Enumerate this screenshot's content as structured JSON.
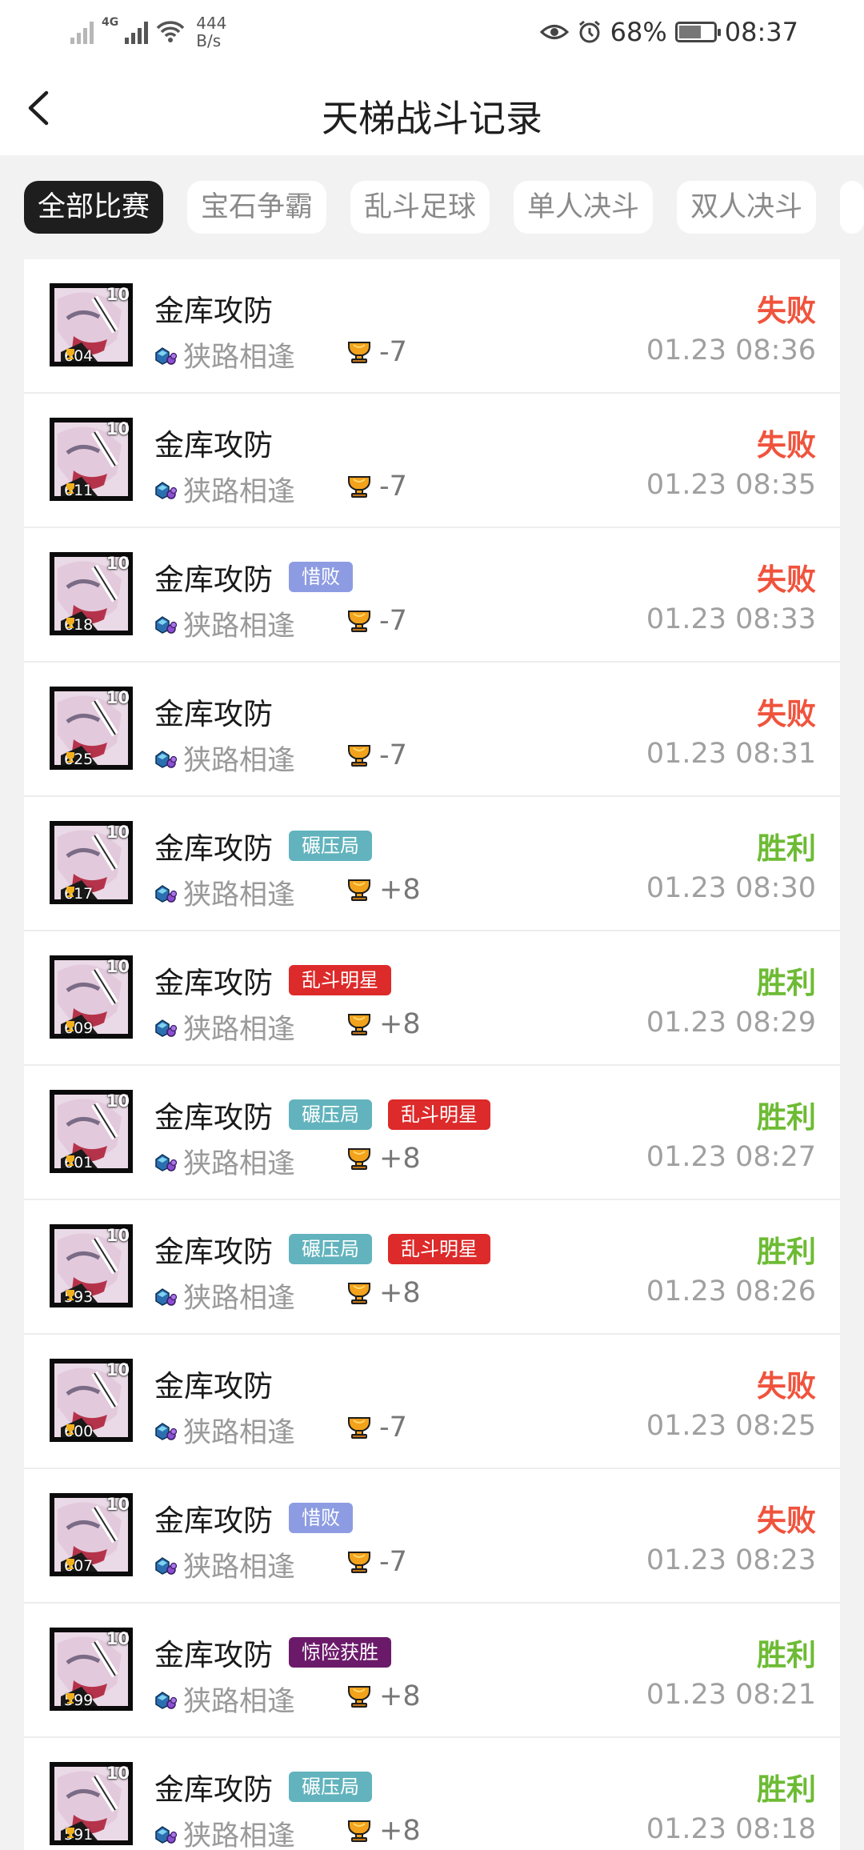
{
  "status_bar": {
    "net_speed_value": "444",
    "net_speed_unit": "B/s",
    "network_type": "4G",
    "battery": "68%",
    "battery_level": 0.68,
    "time": "08:37"
  },
  "header": {
    "title": "天梯战斗记录"
  },
  "filters": [
    {
      "label": "全部比赛",
      "active": true
    },
    {
      "label": "宝石争霸",
      "active": false
    },
    {
      "label": "乱斗足球",
      "active": false
    },
    {
      "label": "单人决斗",
      "active": false
    },
    {
      "label": "双人决斗",
      "active": false
    }
  ],
  "colors": {
    "loss": "#f0533d",
    "win": "#6dbb34",
    "tag_惜败": "#8d9ce2",
    "tag_碾压局": "#62b3bd",
    "tag_乱斗明星": "#dd2a2a",
    "tag_惊险获胜": "#6b1a6a"
  },
  "battles": [
    {
      "level": "10",
      "trophies": "604",
      "mode": "金库攻防",
      "tags": [],
      "map": "狭路相逢",
      "delta": "-7",
      "result": "失败",
      "outcome": "loss",
      "time": "01.23 08:36"
    },
    {
      "level": "10",
      "trophies": "611",
      "mode": "金库攻防",
      "tags": [],
      "map": "狭路相逢",
      "delta": "-7",
      "result": "失败",
      "outcome": "loss",
      "time": "01.23 08:35"
    },
    {
      "level": "10",
      "trophies": "618",
      "mode": "金库攻防",
      "tags": [
        "惜败"
      ],
      "map": "狭路相逢",
      "delta": "-7",
      "result": "失败",
      "outcome": "loss",
      "time": "01.23 08:33"
    },
    {
      "level": "10",
      "trophies": "625",
      "mode": "金库攻防",
      "tags": [],
      "map": "狭路相逢",
      "delta": "-7",
      "result": "失败",
      "outcome": "loss",
      "time": "01.23 08:31"
    },
    {
      "level": "10",
      "trophies": "617",
      "mode": "金库攻防",
      "tags": [
        "碾压局"
      ],
      "map": "狭路相逢",
      "delta": "+8",
      "result": "胜利",
      "outcome": "win",
      "time": "01.23 08:30"
    },
    {
      "level": "10",
      "trophies": "609",
      "mode": "金库攻防",
      "tags": [
        "乱斗明星"
      ],
      "map": "狭路相逢",
      "delta": "+8",
      "result": "胜利",
      "outcome": "win",
      "time": "01.23 08:29"
    },
    {
      "level": "10",
      "trophies": "601",
      "mode": "金库攻防",
      "tags": [
        "碾压局",
        "乱斗明星"
      ],
      "map": "狭路相逢",
      "delta": "+8",
      "result": "胜利",
      "outcome": "win",
      "time": "01.23 08:27"
    },
    {
      "level": "10",
      "trophies": "593",
      "mode": "金库攻防",
      "tags": [
        "碾压局",
        "乱斗明星"
      ],
      "map": "狭路相逢",
      "delta": "+8",
      "result": "胜利",
      "outcome": "win",
      "time": "01.23 08:26"
    },
    {
      "level": "10",
      "trophies": "600",
      "mode": "金库攻防",
      "tags": [],
      "map": "狭路相逢",
      "delta": "-7",
      "result": "失败",
      "outcome": "loss",
      "time": "01.23 08:25"
    },
    {
      "level": "10",
      "trophies": "607",
      "mode": "金库攻防",
      "tags": [
        "惜败"
      ],
      "map": "狭路相逢",
      "delta": "-7",
      "result": "失败",
      "outcome": "loss",
      "time": "01.23 08:23"
    },
    {
      "level": "10",
      "trophies": "599",
      "mode": "金库攻防",
      "tags": [
        "惊险获胜"
      ],
      "map": "狭路相逢",
      "delta": "+8",
      "result": "胜利",
      "outcome": "win",
      "time": "01.23 08:21"
    },
    {
      "level": "10",
      "trophies": "591",
      "mode": "金库攻防",
      "tags": [
        "碾压局"
      ],
      "map": "狭路相逢",
      "delta": "+8",
      "result": "胜利",
      "outcome": "win",
      "time": "01.23 08:18"
    }
  ]
}
